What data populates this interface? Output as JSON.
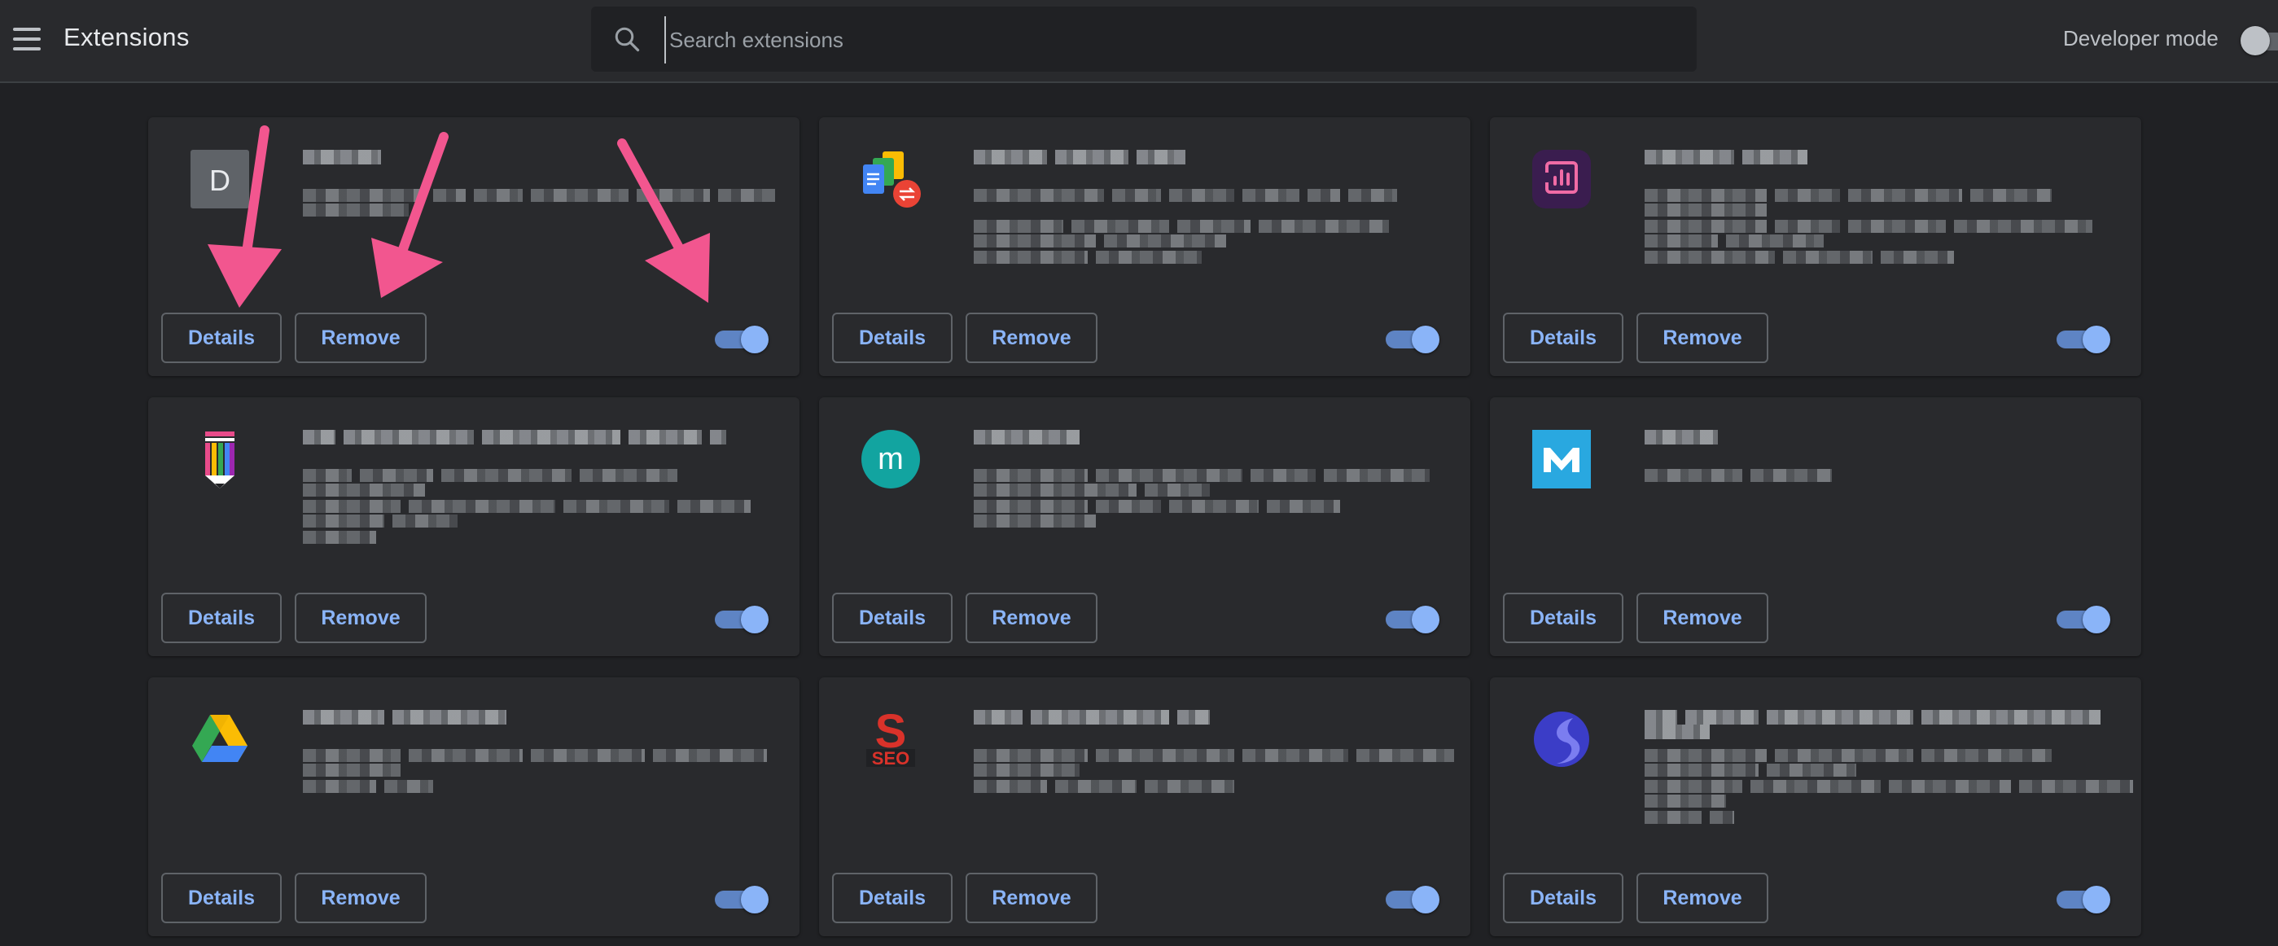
{
  "header": {
    "title": "Extensions",
    "search_placeholder": "Search extensions",
    "dev_mode_label": "Developer mode",
    "dev_mode_on": false
  },
  "cards": [
    {
      "icon": "letter-d-icon",
      "icon_letter": "D",
      "details_label": "Details",
      "remove_label": "Remove",
      "enabled": true
    },
    {
      "icon": "docs-sheets-slides-converter-icon",
      "details_label": "Details",
      "remove_label": "Remove",
      "enabled": true
    },
    {
      "icon": "analytics-chart-icon",
      "details_label": "Details",
      "remove_label": "Remove",
      "enabled": true
    },
    {
      "icon": "pencil-stripes-icon",
      "details_label": "Details",
      "remove_label": "Remove",
      "enabled": true
    },
    {
      "icon": "teal-m-circle-icon",
      "icon_letter": "m",
      "details_label": "Details",
      "remove_label": "Remove",
      "enabled": true
    },
    {
      "icon": "blue-m-square-icon",
      "details_label": "Details",
      "remove_label": "Remove",
      "enabled": true
    },
    {
      "icon": "google-drive-icon",
      "details_label": "Details",
      "remove_label": "Remove",
      "enabled": true
    },
    {
      "icon": "seo-s-icon",
      "icon_letter": "SEO",
      "details_label": "Details",
      "remove_label": "Remove",
      "enabled": true
    },
    {
      "icon": "purple-s-circle-icon",
      "details_label": "Details",
      "remove_label": "Remove",
      "enabled": true
    }
  ],
  "colors": {
    "background": "#202124",
    "card": "#292a2d",
    "accent": "#8ab4f8",
    "annotation_arrow": "#f2568f"
  }
}
